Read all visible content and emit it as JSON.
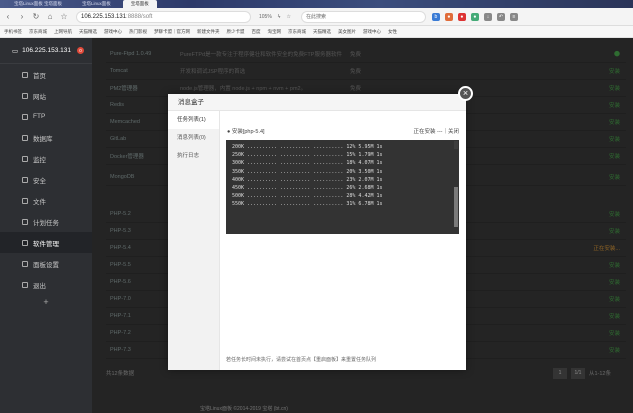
{
  "browser": {
    "tabs": [
      "宝塔Linux面板 宝塔面板",
      "宝塔Linux面板",
      "宝塔面板"
    ],
    "url_host": "106.225.153.131",
    "url_rest": ":8888/soft",
    "zoom": "105%",
    "search_placeholder": "在此搜索"
  },
  "bookmarks": [
    "手机书签",
    "京东商城",
    "上网导航",
    "天猫精选",
    "游戏中心",
    "热门影视",
    "梦聊卡盟｜官方网",
    "新建文件夹",
    "原少卡盟",
    "百度",
    "淘宝网",
    "京东商城",
    "天猫精选",
    "美女图片",
    "游戏中心",
    "女性"
  ],
  "sidebar": {
    "server_ip": "106.225.153.131",
    "badge": "0",
    "items": [
      {
        "label": "首页"
      },
      {
        "label": "网站"
      },
      {
        "label": "FTP"
      },
      {
        "label": "数据库"
      },
      {
        "label": "监控"
      },
      {
        "label": "安全"
      },
      {
        "label": "文件"
      },
      {
        "label": "计划任务"
      },
      {
        "label": "软件管理"
      },
      {
        "label": "面板设置"
      },
      {
        "label": "退出"
      }
    ],
    "plus": "+"
  },
  "software_rows": [
    {
      "name": "Pure-Ftpd 1.0.49",
      "desc": "PureFTPd是一款专注于程序健壮和软件安全的免费FTP服务器软件",
      "price": "免费",
      "status": ""
    },
    {
      "name": "Tomcat",
      "desc": "开发和调试JSP程序的首选",
      "price": "免费",
      "status": "安装"
    },
    {
      "name": "PM2管理器",
      "desc": "node.js管理器，内置 node.js + npm + nvm + pm2。",
      "price": "免费",
      "status": "安装"
    },
    {
      "name": "Redis",
      "desc": "",
      "price": "",
      "status": "安装"
    },
    {
      "name": "Memcached",
      "desc": "",
      "price": "",
      "status": "安装"
    },
    {
      "name": "GitLab",
      "desc": "",
      "price": "",
      "status": "安装"
    },
    {
      "name": "Docker管理器",
      "desc": "",
      "price": "",
      "status": "安装"
    },
    {
      "name": "MongoDB",
      "desc": "",
      "price": "",
      "status": "安装"
    },
    {
      "name": "PHP-5.2",
      "desc": "",
      "price": "",
      "status": "安装"
    },
    {
      "name": "PHP-5.3",
      "desc": "",
      "price": "",
      "status": "安装"
    },
    {
      "name": "PHP-5.4",
      "desc": "",
      "price": "",
      "status": "正在安装..."
    },
    {
      "name": "PHP-5.5",
      "desc": "",
      "price": "",
      "status": "安装"
    },
    {
      "name": "PHP-5.6",
      "desc": "",
      "price": "",
      "status": "安装"
    },
    {
      "name": "PHP-7.0",
      "desc": "",
      "price": "",
      "status": "安装"
    },
    {
      "name": "PHP-7.1",
      "desc": "",
      "price": "",
      "status": "安装"
    },
    {
      "name": "PHP-7.2",
      "desc": "",
      "price": "",
      "status": "安装"
    },
    {
      "name": "PHP-7.3",
      "desc": "",
      "price": "",
      "status": "安装"
    }
  ],
  "footer": {
    "count": "共12条数据",
    "page_first": "1",
    "page_total": "1/1",
    "page_range": "从1-12条",
    "copyright": "宝塔Linux面板 ©2014-2019 宝塔 (bt.cn)"
  },
  "dialog": {
    "title": "消息盒子",
    "close": "×",
    "tabs": [
      "任务列表(1)",
      "消息列表(0)",
      "执行日志"
    ],
    "task_name": "● 安装[php-5.4]",
    "task_status": "正在安装 ---｜关闭",
    "log_lines": [
      "200K .......... .......... .......... 12% 5.95M 1s",
      "250K .......... .......... .......... 15% 1.79M 1s",
      "300K .......... .......... .......... 18% 4.07M 1s",
      "350K .......... .......... .......... 20% 3.50M 1s",
      "400K .......... .......... .......... 23% 2.07M 1s",
      "450K .......... .......... .......... 26% 2.68M 1s",
      "500K .......... .......... .......... 28% 4.42M 1s",
      "550K .......... .......... .......... 31% 6.78M 1s"
    ],
    "note": "若任务长时间未执行，请尝试在首页点【重启面板】来重置任务队列"
  },
  "colors": {
    "sidebar_bg": "#2d2f33",
    "accent_green": "#4caf50",
    "badge_red": "#e04a3a"
  }
}
